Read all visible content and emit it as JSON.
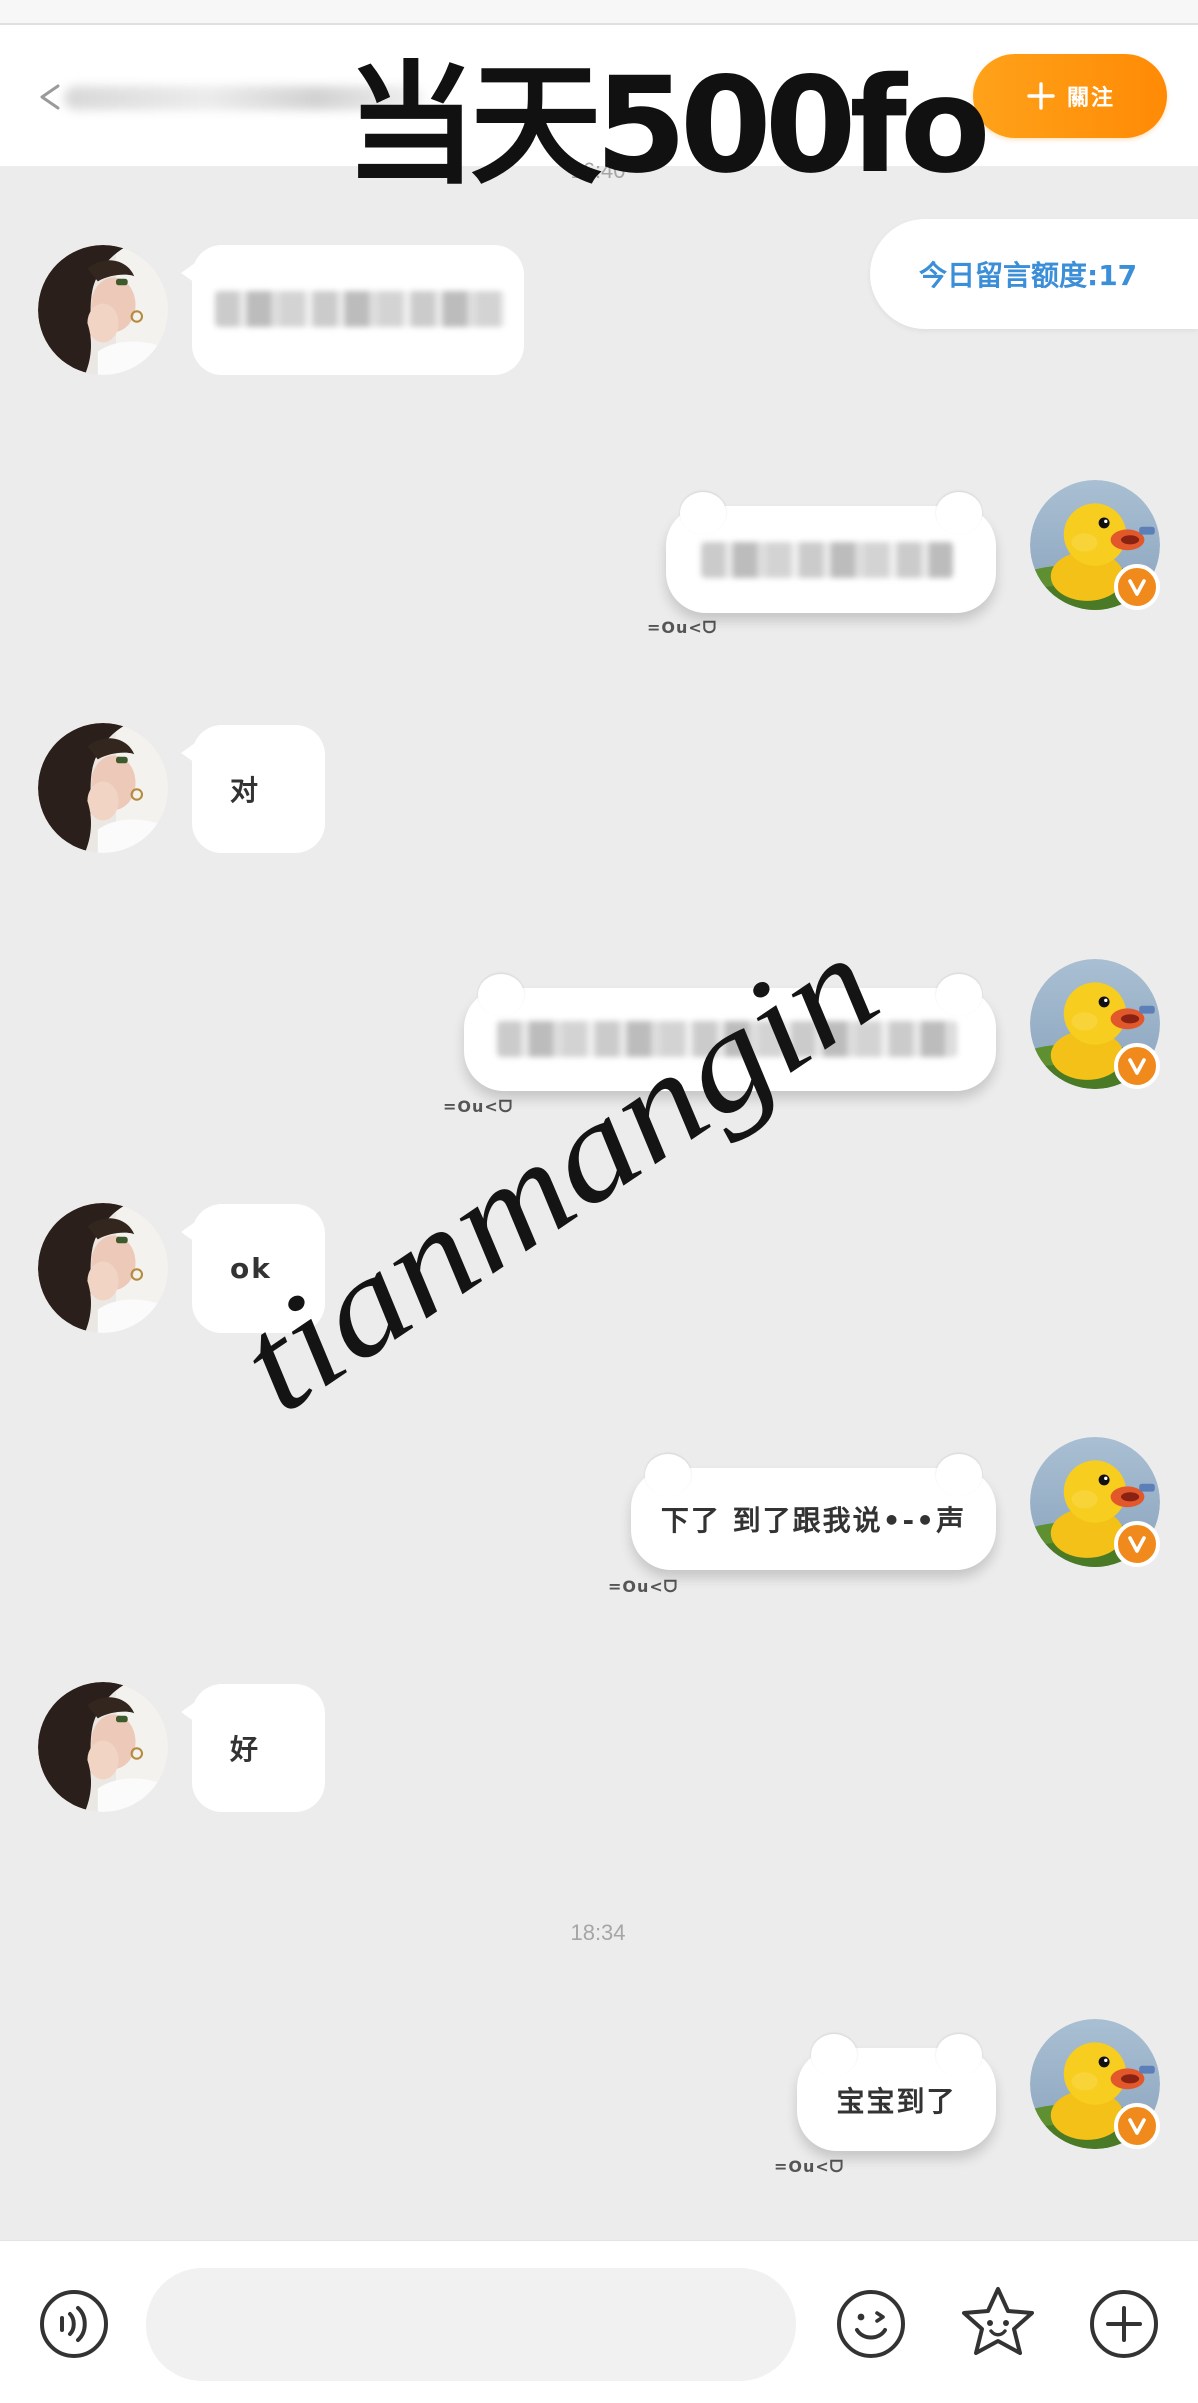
{
  "header": {
    "back_icon": "back-arrow-icon",
    "first_timestamp": "16:40",
    "overlay_caption": "当天500fo",
    "follow_icon": "plus-icon",
    "follow_label": "關注"
  },
  "quota": {
    "label": "今日留言额度:17"
  },
  "messages": [
    {
      "side": "left",
      "avatar": "girl-avatar",
      "blurred": true
    },
    {
      "side": "right",
      "avatar": "duck-avatar",
      "verified": true,
      "blurred": true,
      "decoration": "=Ou<ᗜ"
    },
    {
      "side": "left",
      "avatar": "girl-avatar",
      "text": "对"
    },
    {
      "side": "right",
      "avatar": "duck-avatar",
      "verified": true,
      "blurred": true,
      "decoration": "=Ou<ᗜ"
    },
    {
      "side": "left",
      "avatar": "girl-avatar",
      "text": "ok"
    },
    {
      "side": "right",
      "avatar": "duck-avatar",
      "verified": true,
      "text": "下了 到了跟我说•-•声",
      "decoration": "=Ou<ᗜ"
    },
    {
      "side": "left",
      "avatar": "girl-avatar",
      "text": "好"
    },
    {
      "side": "right",
      "avatar": "duck-avatar",
      "verified": true,
      "text": "宝宝到了",
      "decoration": "=Ou<ᗜ"
    }
  ],
  "second_timestamp": "18:34",
  "watermark": "tianmangin",
  "input_bar": {
    "icons": [
      "voice-icon",
      "emoji-icon",
      "sticker-star-icon",
      "add-icon"
    ],
    "input_value": ""
  },
  "colors": {
    "background": "#ececec",
    "follow_button": "#ff9410",
    "quota_text": "#3b8ed8",
    "verified_badge": "#f08a1c",
    "bubble": "#ffffff"
  }
}
